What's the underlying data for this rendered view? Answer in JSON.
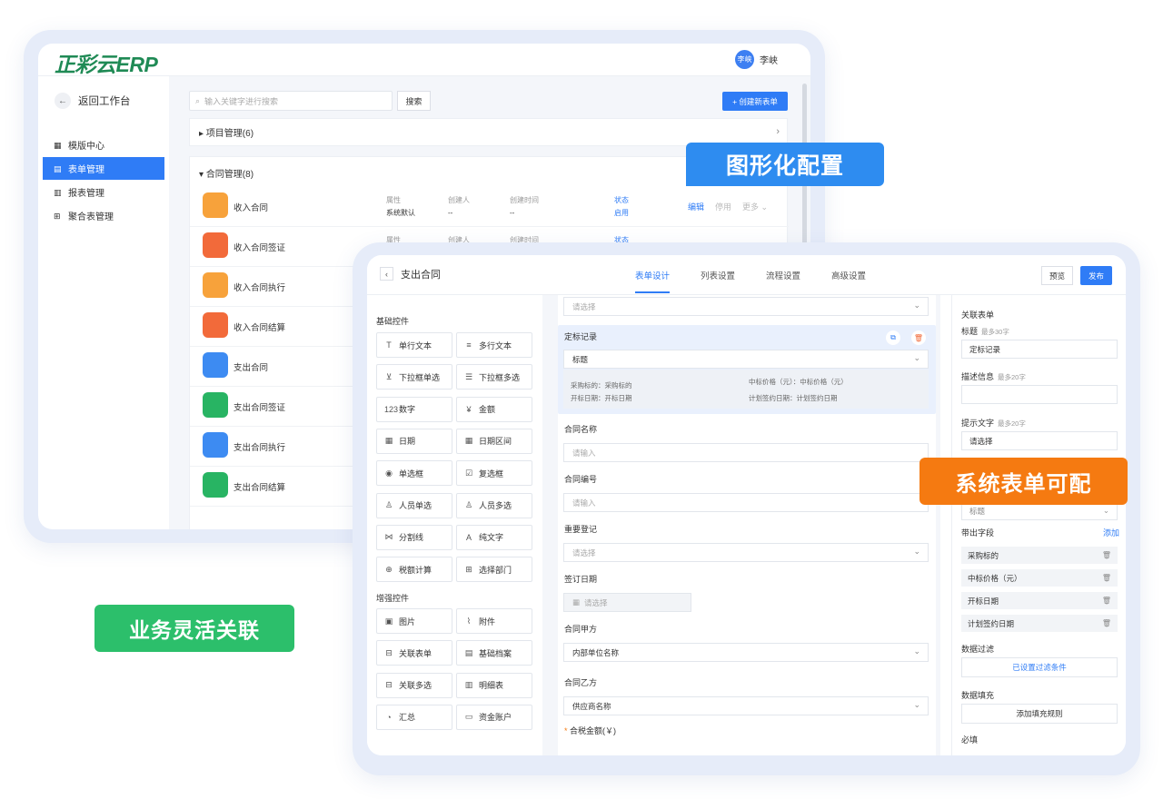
{
  "back": {
    "logo": "正彩云ERP",
    "user": {
      "avatar": "李峡",
      "name": "李峡"
    },
    "back_label": "返回工作台",
    "nav": [
      {
        "label": "模版中心",
        "icon": "grid-icon"
      },
      {
        "label": "表单管理",
        "icon": "form-icon",
        "active": true
      },
      {
        "label": "报表管理",
        "icon": "report-icon"
      },
      {
        "label": "聚合表管理",
        "icon": "aggregate-icon"
      }
    ],
    "search_placeholder": "输入关键字进行搜索",
    "search_button": "搜索",
    "create_button": "+ 创建新表单",
    "group1": "▸ 项目管理(6)",
    "group2": "▾ 合同管理(8)",
    "meta_labels": {
      "attr": "属性",
      "creator": "创建人",
      "created": "创建时间",
      "status": "状态"
    },
    "meta_values": {
      "attr": "系统默认",
      "creator": "--",
      "created": "--",
      "status": "启用"
    },
    "actions": {
      "edit": "编辑",
      "disable": "停用",
      "more": "更多 ⌄"
    },
    "rows": [
      {
        "name": "收入合同",
        "color": "#f7a23b"
      },
      {
        "name": "收入合同签证",
        "color": "#f26a3a"
      },
      {
        "name": "收入合同执行",
        "color": "#f7a23b"
      },
      {
        "name": "收入合同结算",
        "color": "#f26a3a"
      },
      {
        "name": "支出合同",
        "color": "#3d8bf2"
      },
      {
        "name": "支出合同签证",
        "color": "#28b463"
      },
      {
        "name": "支出合同执行",
        "color": "#3d8bf2"
      },
      {
        "name": "支出合同结算",
        "color": "#28b463"
      }
    ]
  },
  "front": {
    "title": "支出合同",
    "tabs": [
      "表单设计",
      "列表设置",
      "流程设置",
      "高级设置"
    ],
    "preview": "预览",
    "publish": "发布",
    "basic_title": "基础控件",
    "basic": [
      {
        "label": "单行文本",
        "icon": "T"
      },
      {
        "label": "多行文本",
        "icon": "≡"
      },
      {
        "label": "下拉框单选",
        "icon": "⊻"
      },
      {
        "label": "下拉框多选",
        "icon": "☰"
      },
      {
        "label": "数字",
        "icon": "123"
      },
      {
        "label": "金额",
        "icon": "¥"
      },
      {
        "label": "日期",
        "icon": "▦"
      },
      {
        "label": "日期区间",
        "icon": "▦"
      },
      {
        "label": "单选框",
        "icon": "◉"
      },
      {
        "label": "复选框",
        "icon": "☑"
      },
      {
        "label": "人员单选",
        "icon": "♙"
      },
      {
        "label": "人员多选",
        "icon": "♙"
      },
      {
        "label": "分割线",
        "icon": "⋈"
      },
      {
        "label": "纯文字",
        "icon": "A"
      },
      {
        "label": "税额计算",
        "icon": "⊕"
      },
      {
        "label": "选择部门",
        "icon": "⊞"
      }
    ],
    "adv_title": "增强控件",
    "adv": [
      {
        "label": "图片",
        "icon": "▣"
      },
      {
        "label": "附件",
        "icon": "⌇"
      },
      {
        "label": "关联表单",
        "icon": "⊟"
      },
      {
        "label": "基础档案",
        "icon": "▤"
      },
      {
        "label": "关联多选",
        "icon": "⊟"
      },
      {
        "label": "明细表",
        "icon": "▥"
      },
      {
        "label": "汇总",
        "icon": "◔"
      },
      {
        "label": "资金账户",
        "icon": "▭"
      }
    ],
    "canvas": {
      "top_select": "请选择",
      "block_title": "定标记录",
      "block_select": "标题",
      "block_info": {
        "a1": "采购标的：采购标的",
        "a2": "中标价格（元）：中标价格（元）",
        "b1": "开标日期：开标日期",
        "b2": "计划签约日期：计划签约日期"
      },
      "fields": [
        {
          "label": "合同名称",
          "value": "请输入",
          "select": false
        },
        {
          "label": "合同编号",
          "value": "请输入",
          "select": false
        },
        {
          "label": "重要登记",
          "value": "请选择",
          "select": true
        },
        {
          "label": "签订日期",
          "value": "请选择",
          "select": false,
          "date": true
        },
        {
          "label": "合同甲方",
          "value": "内部单位名称",
          "select": true,
          "filled": true
        },
        {
          "label": "合同乙方",
          "value": "供应商名称",
          "select": true,
          "filled": true
        }
      ],
      "last_label": "合税金额(￥)"
    },
    "props": {
      "head": "关联表单",
      "title_label": "标题",
      "title_hint": "最多30字",
      "title_value": "定标记录",
      "desc_label": "描述信息",
      "desc_hint": "最多20字",
      "tip_label": "提示文字",
      "tip_hint": "最多20字",
      "tip_value": "请选择",
      "sel_value": "标题",
      "bring_label": "带出字段",
      "bring_add": "添加",
      "bring_fields": [
        "采购标的",
        "中标价格（元）",
        "开标日期",
        "计划签约日期"
      ],
      "filter_label": "数据过滤",
      "filter_value": "已设置过滤条件",
      "fill_label": "数据填充",
      "fill_value": "添加填充规则",
      "required_label": "必填"
    }
  },
  "callouts": {
    "graphic": "图形化配置",
    "system": "系统表单可配",
    "business": "业务灵活关联"
  },
  "colors": {
    "primary": "#2f7cf6",
    "callout_blue": "#2e8cf0",
    "callout_orange": "#f57a11",
    "callout_green": "#2cbf6b"
  }
}
